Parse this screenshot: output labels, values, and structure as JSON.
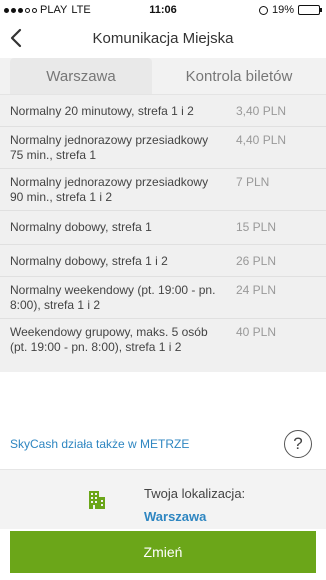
{
  "status": {
    "carrier": "PLAY",
    "network": "LTE",
    "time": "11:06",
    "battery": "19%",
    "battery_level": 0.19
  },
  "nav": {
    "title": "Komunikacja Miejska",
    "back_icon": "chevron-left-icon"
  },
  "tabs": [
    {
      "label": "Warszawa",
      "active": true
    },
    {
      "label": "Kontrola biletów",
      "active": false
    }
  ],
  "tickets": [
    {
      "name": "Normalny 20 minutowy, strefa 1 i 2",
      "price": "3,40 PLN"
    },
    {
      "name": "Normalny jednorazowy przesiadkowy 75 min., strefa 1",
      "price": "4,40 PLN"
    },
    {
      "name": "Normalny jednorazowy przesiadkowy 90 min., strefa 1 i 2",
      "price": "7 PLN"
    },
    {
      "name": "Normalny dobowy, strefa 1",
      "price": "15 PLN"
    },
    {
      "name": "Normalny dobowy, strefa 1 i 2",
      "price": "26 PLN"
    },
    {
      "name": "Normalny weekendowy (pt. 19:00 - pn. 8:00), strefa 1 i 2",
      "price": "24 PLN"
    },
    {
      "name": "Weekendowy grupowy, maks. 5 osób (pt. 19:00 - pn. 8:00), strefa 1 i 2",
      "price": "40 PLN"
    }
  ],
  "skycash_link": "SkyCash działa także w METRZE",
  "help_label": "?",
  "location": {
    "label": "Twoja lokalizacja:",
    "value": "Warszawa",
    "icon": "building-icon"
  },
  "change_button": "Zmień",
  "colors": {
    "accent_green": "#6ba619",
    "link_blue": "#2e86c1",
    "battery_red": "#e53935"
  }
}
